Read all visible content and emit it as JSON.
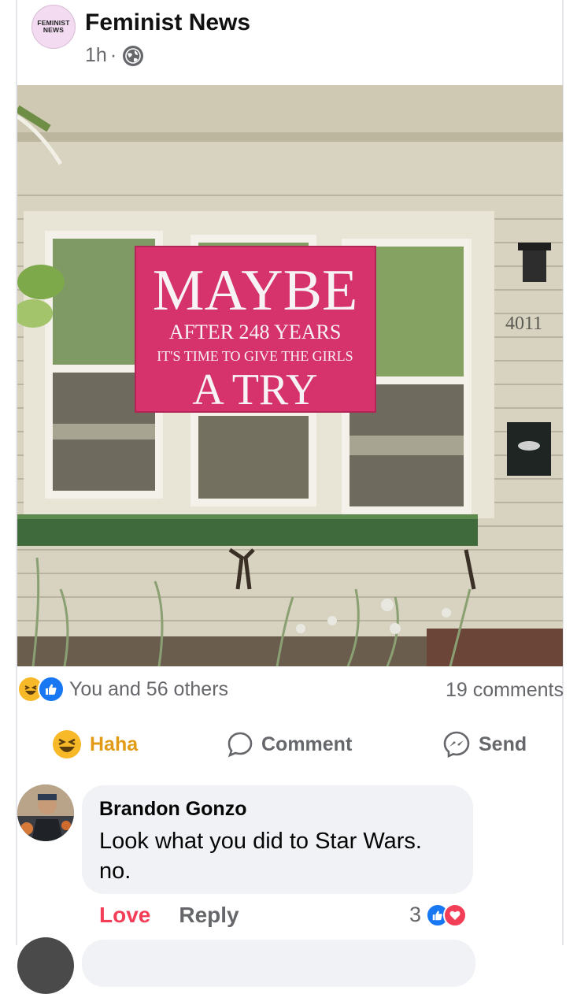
{
  "post": {
    "page_avatar_lines": [
      "FEMINIST",
      "NEWS"
    ],
    "page_name": "Feminist News",
    "time": "1h",
    "separator": "·",
    "privacy_icon": "globe-icon"
  },
  "photo": {
    "banner_lines": [
      "MAYBE",
      "AFTER 248 YEARS",
      "IT'S TIME TO GIVE THE GIRLS",
      "A TRY"
    ],
    "house_number": "4011",
    "banner_color": "#d6336c"
  },
  "engagement": {
    "reaction_icons": [
      "haha-icon",
      "like-icon"
    ],
    "reactions_text": "You and 56 others",
    "comments_text": "19 comments"
  },
  "actions": {
    "haha_label": "Haha",
    "comment_label": "Comment",
    "send_label": "Send"
  },
  "comment": {
    "author": "Brandon Gonzo",
    "text_line1": "Look what you did to Star Wars.",
    "text_line2": "no.",
    "love_label": "Love",
    "reply_label": "Reply",
    "reaction_count": "3"
  },
  "colors": {
    "haha": "#f7b928",
    "like": "#1877f2",
    "love": "#f33e58",
    "muted": "#65676b"
  }
}
